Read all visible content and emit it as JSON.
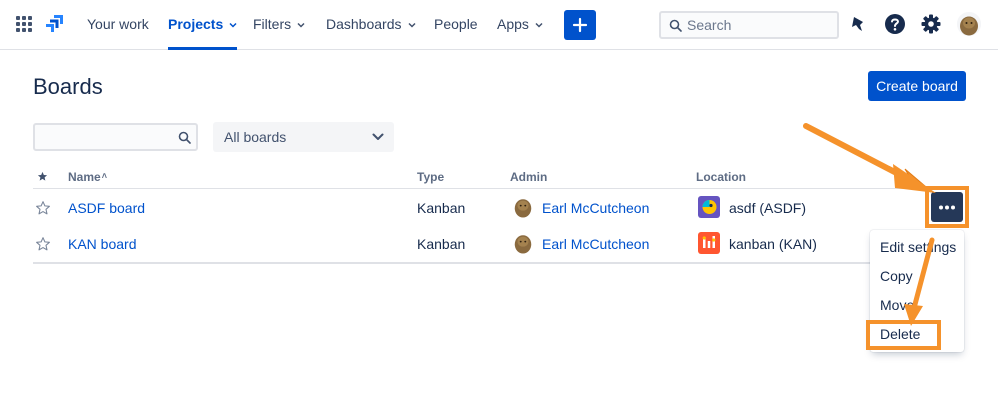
{
  "nav": {
    "items": [
      {
        "label": "Your work"
      },
      {
        "label": "Projects"
      },
      {
        "label": "Filters"
      },
      {
        "label": "Dashboards"
      },
      {
        "label": "People"
      },
      {
        "label": "Apps"
      }
    ],
    "search_placeholder": "Search"
  },
  "page": {
    "title": "Boards",
    "create_button": "Create board",
    "filter_placeholder": "",
    "board_filter": "All boards"
  },
  "table": {
    "columns": [
      "Name",
      "Type",
      "Admin",
      "Location"
    ],
    "sort_indicator": "˄",
    "rows": [
      {
        "name": "ASDF board",
        "type": "Kanban",
        "admin": "Earl McCutcheon",
        "location": "asdf (ASDF)"
      },
      {
        "name": "KAN board",
        "type": "Kanban",
        "admin": "Earl McCutcheon",
        "location": "kanban (KAN)"
      }
    ]
  },
  "menu": {
    "items": [
      "Edit settings",
      "Copy",
      "Move",
      "Delete"
    ]
  },
  "colors": {
    "primary": "#0052cc",
    "annotation": "#f5922b",
    "more_button": "#253858"
  }
}
